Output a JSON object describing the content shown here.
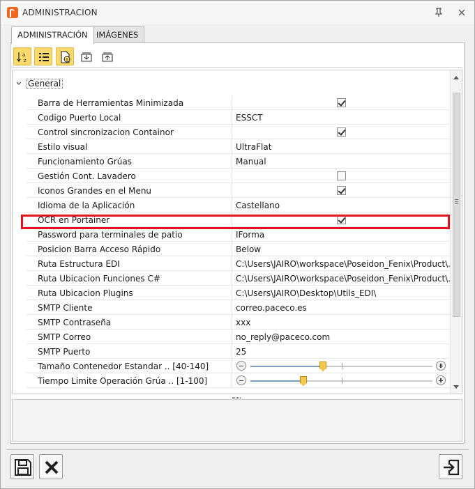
{
  "window": {
    "title": "ADMINISTRACION"
  },
  "tabs": [
    {
      "label": "ADMINISTRACIÓN",
      "active": true
    },
    {
      "label": "IMÁGENES",
      "active": false
    }
  ],
  "toolbar": {
    "buttons": [
      {
        "icon": "sort-alphabetical-icon",
        "active": true
      },
      {
        "icon": "categorized-list-icon",
        "active": true
      },
      {
        "icon": "property-pages-icon",
        "active": true
      },
      {
        "icon": "export-icon",
        "active": false
      },
      {
        "icon": "import-icon",
        "active": false
      }
    ]
  },
  "grid": {
    "group": "General",
    "rows": [
      {
        "name": "Barra de Herramientas Minimizada",
        "type": "check",
        "checked": true
      },
      {
        "name": "Codigo Puerto Local",
        "type": "text",
        "value": "ESSCT"
      },
      {
        "name": "Control sincronizacion Containor",
        "type": "check",
        "checked": true
      },
      {
        "name": "Estilo visual",
        "type": "text",
        "value": "UltraFlat"
      },
      {
        "name": "Funcionamiento Grúas",
        "type": "text",
        "value": "Manual"
      },
      {
        "name": "Gestión Cont. Lavadero",
        "type": "check",
        "checked": false
      },
      {
        "name": "Iconos Grandes en el Menu",
        "type": "check",
        "checked": true
      },
      {
        "name": "Idioma de la Aplicación",
        "type": "text",
        "value": "Castellano"
      },
      {
        "name": "OCR en Portainer",
        "type": "check",
        "checked": true,
        "highlighted": true
      },
      {
        "name": "Password para terminales de patio",
        "type": "text",
        "value": "IForma"
      },
      {
        "name": "Posicion Barra Acceso Rápido",
        "type": "text",
        "value": "Below"
      },
      {
        "name": "Ruta Estructura EDI",
        "type": "text",
        "value": "C:\\Users\\JAIRO\\workspace\\Poseidon_Fenix\\Product\\..."
      },
      {
        "name": "Ruta Ubicacion Funciones C#",
        "type": "text",
        "value": "C:\\Users\\JAIRO\\workspace\\Poseidon_Fenix\\Product\\..."
      },
      {
        "name": "Ruta Ubicacion Plugins",
        "type": "text",
        "value": "C:\\Users\\JAIRO\\Desktop\\Utils_EDI\\"
      },
      {
        "name": "SMTP Cliente",
        "type": "text",
        "value": "correo.paceco.es"
      },
      {
        "name": "SMTP Contraseña",
        "type": "text",
        "value": "xxx"
      },
      {
        "name": "SMTP Correo",
        "type": "text",
        "value": "no_reply@paceco.com"
      },
      {
        "name": "SMTP Puerto",
        "type": "text",
        "value": "25"
      },
      {
        "name": "Tamaño Contenedor Estandar .. [40-140]",
        "type": "slider",
        "fraction": 0.4
      },
      {
        "name": "Tiempo Limite Operación Grúa .. [1-100]",
        "type": "slider",
        "fraction": 0.29
      }
    ]
  },
  "bottom": {
    "buttons": [
      {
        "icon": "save-icon"
      },
      {
        "icon": "cancel-icon"
      },
      {
        "icon": "exit-icon"
      }
    ]
  },
  "colors": {
    "highlight": "#e0141e",
    "toolbar_active": "#fbd96a"
  }
}
